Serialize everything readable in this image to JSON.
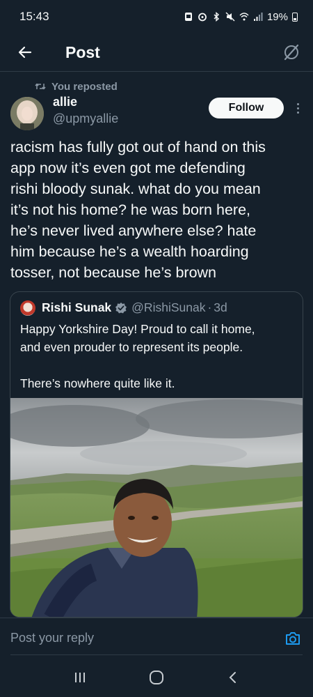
{
  "status_bar": {
    "time": "15:43",
    "battery": "19%",
    "icons": [
      "photo-icon",
      "alarm-icon",
      "bluetooth-icon",
      "mute-icon",
      "wifi-icon",
      "signal-icon",
      "battery-icon"
    ]
  },
  "header": {
    "title": "Post",
    "back_icon": "back-arrow-icon",
    "grok_icon": "grok-icon"
  },
  "repost": {
    "label": "You reposted"
  },
  "post": {
    "author_name": "allie",
    "author_handle": "@upmyallie",
    "follow_label": "Follow",
    "text": "racism has fully got out of hand on this\napp now it’s even got me defending\nrishi bloody sunak. what do you mean\nit’s not his home? he was born here,\nhe’s never lived anywhere else? hate\nhim because he’s a wealth hoarding\ntosser, not because he’s brown"
  },
  "quote": {
    "name": "Rishi Sunak",
    "handle": "@RishiSunak",
    "separator": "·",
    "time": "3d",
    "text": "Happy Yorkshire Day! Proud to call it home,\nand even prouder to represent its people.\n\nThere’s nowhere quite like it."
  },
  "reply": {
    "placeholder": "Post your reply"
  },
  "colors": {
    "background": "#15202b",
    "text": "#f7f9f9",
    "muted": "#8b98a5",
    "accent": "#1d9bf0",
    "border": "#38444d"
  }
}
